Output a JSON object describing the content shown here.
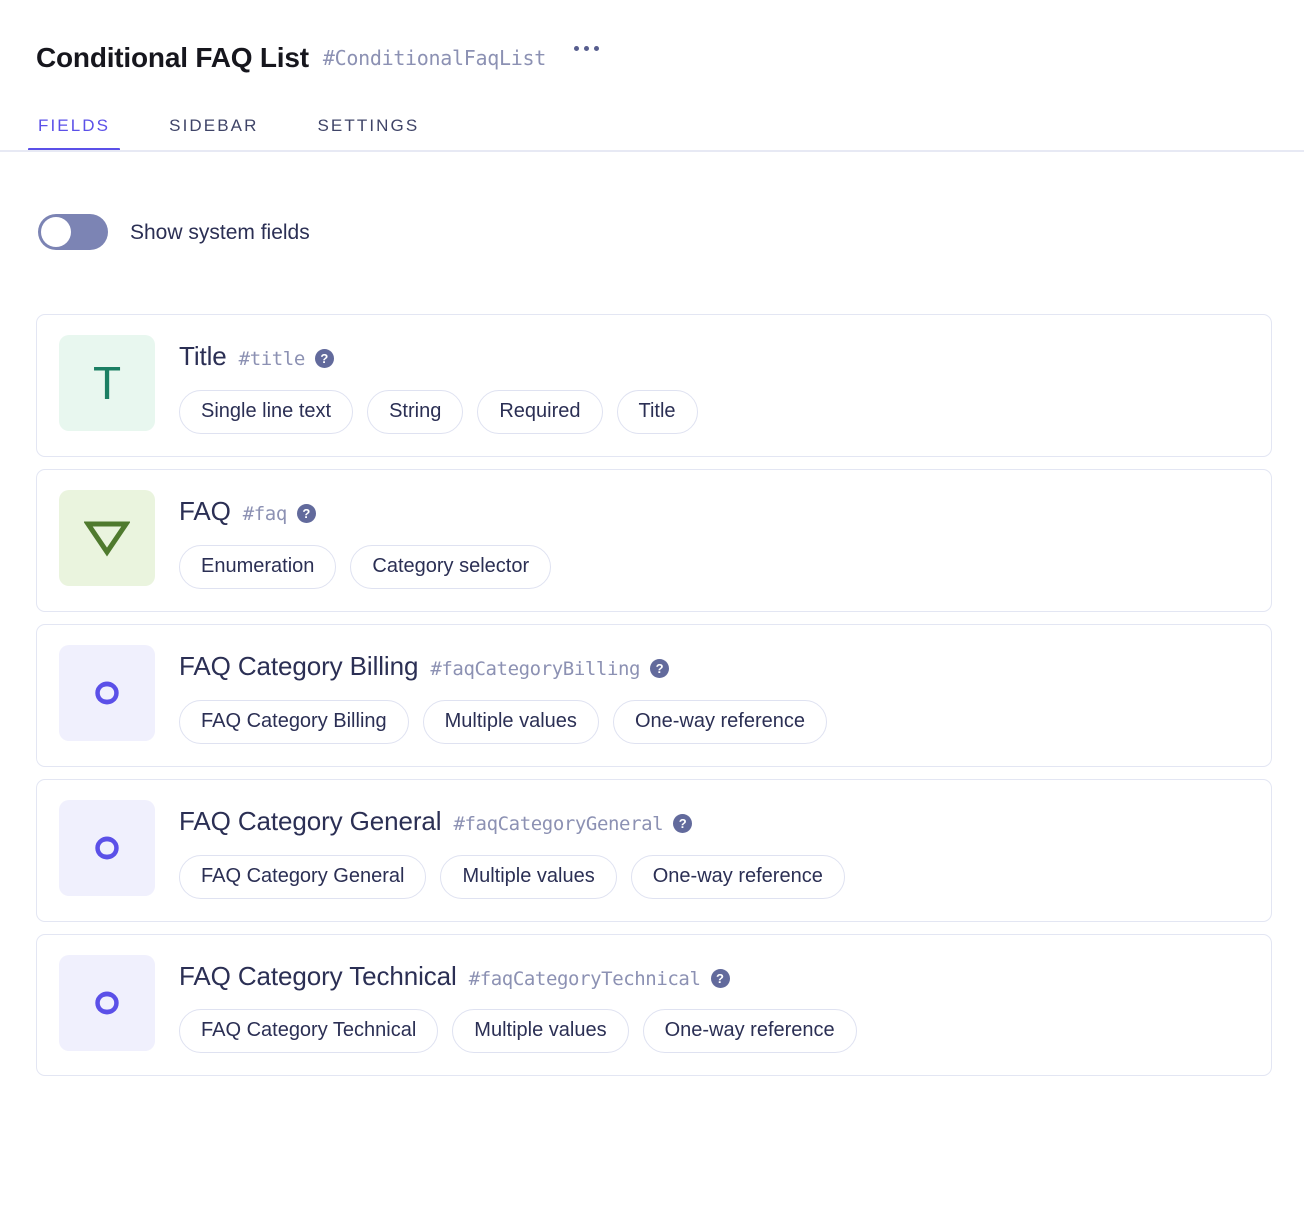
{
  "header": {
    "title": "Conditional FAQ List",
    "slug": "#ConditionalFaqList",
    "menu_label": "More options",
    "accent_color": "#5b50e8"
  },
  "tabs": [
    {
      "label": "FIELDS",
      "active": true
    },
    {
      "label": "SIDEBAR",
      "active": false
    },
    {
      "label": "SETTINGS",
      "active": false
    }
  ],
  "toggle": {
    "label": "Show system fields",
    "state": "off",
    "track_color": "#7c84b4"
  },
  "fields": [
    {
      "name": "Title",
      "slug": "#title",
      "help": "?",
      "icon": "text-field-icon",
      "icon_glyph": "T",
      "icon_bg": "#e8f7ef",
      "icon_fg": "#1b7f63",
      "pills": [
        "Single line text",
        "String",
        "Required",
        "Title"
      ]
    },
    {
      "name": "FAQ",
      "slug": "#faq",
      "help": "?",
      "icon": "enumeration-field-icon",
      "icon_glyph": "triangle-down",
      "icon_bg": "#eaf4de",
      "icon_fg": "#4f7a2e",
      "pills": [
        "Enumeration",
        "Category selector"
      ]
    },
    {
      "name": "FAQ Category Billing",
      "slug": "#faqCategoryBilling",
      "help": "?",
      "icon": "reference-field-icon",
      "icon_glyph": "link",
      "icon_bg": "#f0f0fd",
      "icon_fg": "#5b50e8",
      "pills": [
        "FAQ Category Billing",
        "Multiple values",
        "One-way reference"
      ]
    },
    {
      "name": "FAQ Category General",
      "slug": "#faqCategoryGeneral",
      "help": "?",
      "icon": "reference-field-icon",
      "icon_glyph": "link",
      "icon_bg": "#f0f0fd",
      "icon_fg": "#5b50e8",
      "pills": [
        "FAQ Category General",
        "Multiple values",
        "One-way reference"
      ]
    },
    {
      "name": "FAQ Category Technical",
      "slug": "#faqCategoryTechnical",
      "help": "?",
      "icon": "reference-field-icon",
      "icon_glyph": "link",
      "icon_bg": "#f0f0fd",
      "icon_fg": "#5b50e8",
      "pills": [
        "FAQ Category Technical",
        "Multiple values",
        "One-way reference"
      ]
    }
  ]
}
